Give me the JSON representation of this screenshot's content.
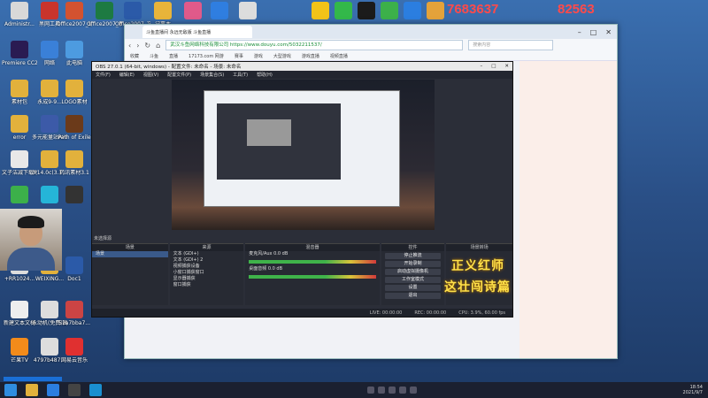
{
  "desktop": {
    "icons": [
      {
        "label": "Administr...",
        "color": "#d8d8d8"
      },
      {
        "label": "黑网工具",
        "color": "#c9342c"
      },
      {
        "label": "Office2007_幻灯片PPT",
        "color": "#d35230"
      },
      {
        "label": "Office2007_表格",
        "color": "#1d7a42"
      },
      {
        "label": "Office2007_文档",
        "color": "#2b5aa8"
      },
      {
        "label": "记事本",
        "color": "#e8b43a"
      },
      {
        "label": "",
        "color": "#e05a8a"
      },
      {
        "label": "",
        "color": "#2f7ee0"
      },
      {
        "label": "",
        "color": "#ddd"
      },
      {
        "label": "Premiere CC2019",
        "color": "#2a1b52"
      },
      {
        "label": "网络",
        "color": "#3a80d8"
      },
      {
        "label": "此电脑",
        "color": "#4d9be0"
      },
      {
        "label": "素材包",
        "color": "#e2b13c"
      },
      {
        "label": "永成9-9...",
        "color": "#e2b13c"
      },
      {
        "label": "LOGO素材",
        "color": "#e2b13c"
      },
      {
        "label": "error",
        "color": "#e2b13c"
      },
      {
        "label": "多元能量站AHK",
        "color": "#3c5aa8"
      },
      {
        "label": "Path of Exile",
        "color": "#6b3a1a"
      },
      {
        "label": "文子洁减下载地址",
        "color": "#e8e8e8"
      },
      {
        "label": "3.14.0c(3.1...",
        "color": "#e2b13c"
      },
      {
        "label": "药讯素材3.1",
        "color": "#e2b13c"
      },
      {
        "label": "",
        "color": "#3cb04a"
      },
      {
        "label": "",
        "color": "#25b5d8"
      },
      {
        "label": "",
        "color": "#333"
      },
      {
        "label": "+RR1024...",
        "color": "#ddd"
      },
      {
        "label": "WEIXING...",
        "color": "#e2b13c"
      },
      {
        "label": "Doc1",
        "color": "#2b5aa8"
      },
      {
        "label": "新建文本文档",
        "color": "#eee"
      },
      {
        "label": "永动机(免费)高级版",
        "color": "#ddd"
      },
      {
        "label": "51a7bba7...",
        "color": "#c44"
      },
      {
        "label": "芒果TV",
        "color": "#f38b1a"
      },
      {
        "label": "4797b487...",
        "color": "#ddd"
      },
      {
        "label": "网易云音乐",
        "color": "#e03030"
      }
    ],
    "top_tray": [
      {
        "name": "tray-app-1",
        "color": "#f2c318"
      },
      {
        "name": "tray-app-2",
        "color": "#33b84a"
      },
      {
        "name": "tray-app-3",
        "color": "#1b1b1b"
      },
      {
        "name": "tray-app-4",
        "color": "#3cb04a"
      },
      {
        "name": "tray-app-5",
        "color": "#2b7ee0"
      },
      {
        "name": "tray-app-6",
        "color": "#e4a23a"
      }
    ],
    "overlay_numbers": [
      "7683637",
      "82563"
    ]
  },
  "browser": {
    "tab_title": "斗鱼直播间 永远无敌版 斗鱼直播",
    "url": "武汉斗鱼网络科技有限公司 https://www.douyu.com/5032211537/",
    "search_placeholder": "搜索内容",
    "bookmarks": [
      "收藏",
      "斗鱼",
      "直播",
      "17173.com 网游",
      "赛事",
      "游戏",
      "大型游戏",
      "游戏直播",
      "视频直播"
    ]
  },
  "obs": {
    "title": "OBS 27.0.1 (64-bit, windows) - 配置文件: 未命名 - 场景: 未命名",
    "menu": [
      "文件(F)",
      "编辑(E)",
      "视图(V)",
      "配置文件(P)",
      "场景集合(S)",
      "工具(T)",
      "帮助(H)"
    ],
    "source_label": "未选择源",
    "panels": {
      "scenes": {
        "title": "场景",
        "items": [
          "场景"
        ]
      },
      "sources": {
        "title": "来源",
        "items": [
          "文本 (GDI+)",
          "文本 (GDI+) 2",
          "视频捕获设备",
          "小窗口捕获窗口",
          "显示器捕获",
          "窗口捕获"
        ]
      },
      "mixer": {
        "title": "混音器",
        "tracks": [
          "麦克风/Aux",
          "桌面音频"
        ],
        "levels": [
          "0.0 dB",
          "0.0 dB"
        ]
      },
      "transitions": {
        "title": "场景转场"
      },
      "controls": {
        "title": "控件",
        "buttons": [
          "停止推流",
          "开始录制",
          "启动虚拟摄像机",
          "工作室模式",
          "设置",
          "退出"
        ]
      }
    },
    "status": [
      "LIVE: 00:00:00",
      "REC: 00:00:00",
      "CPU: 3.9%, 60.00 fps"
    ]
  },
  "captions": [
    "正义红师",
    "这壮闯诗篇"
  ],
  "taskbar": {
    "clock_time": "18:54",
    "clock_date": "2021/9/7"
  }
}
